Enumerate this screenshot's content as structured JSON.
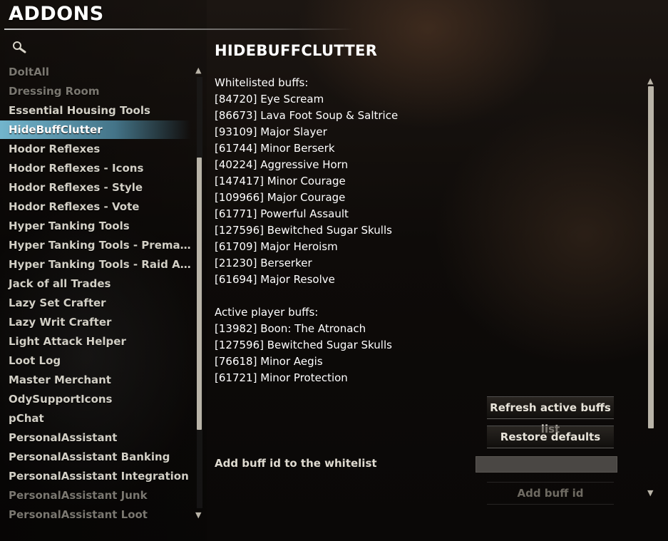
{
  "window": {
    "title": "ADDONS"
  },
  "search": {
    "icon": "magnifier-icon"
  },
  "addons": {
    "items": [
      {
        "label": "DoltAll",
        "state": "dim"
      },
      {
        "label": "Dressing Room",
        "state": "dim"
      },
      {
        "label": "Essential Housing Tools",
        "state": "normal"
      },
      {
        "label": "HideBuffClutter",
        "state": "selected"
      },
      {
        "label": "Hodor Reflexes",
        "state": "normal"
      },
      {
        "label": "Hodor Reflexes - Icons",
        "state": "normal"
      },
      {
        "label": "Hodor Reflexes - Style",
        "state": "normal"
      },
      {
        "label": "Hodor Reflexes - Vote",
        "state": "normal"
      },
      {
        "label": "Hyper Tanking Tools",
        "state": "normal"
      },
      {
        "label": "Hyper Tanking Tools - Premade T...",
        "state": "normal"
      },
      {
        "label": "Hyper Tanking Tools - Raid Alerts",
        "state": "normal"
      },
      {
        "label": "Jack of all Trades",
        "state": "normal"
      },
      {
        "label": "Lazy Set Crafter",
        "state": "normal"
      },
      {
        "label": "Lazy Writ Crafter",
        "state": "normal"
      },
      {
        "label": "Light Attack Helper",
        "state": "normal"
      },
      {
        "label": "Loot Log",
        "state": "normal"
      },
      {
        "label": "Master Merchant",
        "state": "normal"
      },
      {
        "label": "OdySupportIcons",
        "state": "normal"
      },
      {
        "label": "pChat",
        "state": "normal"
      },
      {
        "label": "PersonalAssistant",
        "state": "normal"
      },
      {
        "label": "PersonalAssistant Banking",
        "state": "normal"
      },
      {
        "label": "PersonalAssistant Integration",
        "state": "normal"
      },
      {
        "label": "PersonalAssistant Junk",
        "state": "dim"
      },
      {
        "label": "PersonalAssistant Loot",
        "state": "dim"
      }
    ]
  },
  "panel": {
    "title": "HIDEBUFFCLUTTER",
    "whitelisted_header": "Whitelisted buffs:",
    "whitelisted": [
      "[84720] Eye Scream",
      "[86673] Lava Foot Soup & Saltrice",
      "[93109] Major Slayer",
      "[61744] Minor Berserk",
      "[40224] Aggressive Horn",
      "[147417] Minor Courage",
      "[109966] Major Courage",
      "[61771] Powerful Assault",
      "[127596] Bewitched Sugar Skulls",
      "[61709] Major Heroism",
      "[21230] Berserker",
      "[61694] Major Resolve"
    ],
    "active_header": "Active player buffs:",
    "active": [
      "[13982] Boon: The Atronach",
      "[127596] Bewitched Sugar Skulls",
      "[76618] Minor Aegis",
      "[61721] Minor Protection"
    ],
    "refresh_button": "Refresh active buffs list",
    "restore_button": "Restore defaults",
    "add_label": "Add buff id to the whitelist",
    "add_input_value": "",
    "add_button": "Add buff id"
  },
  "colors": {
    "selected": "#78bed7",
    "text": "#d2cfc5",
    "dim": "#7a7770"
  }
}
